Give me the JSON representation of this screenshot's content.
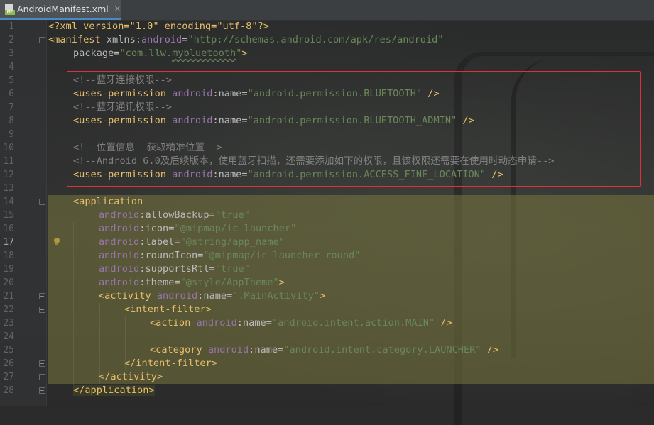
{
  "tab": {
    "title": "AndroidManifest.xml",
    "icon_badge": "MF"
  },
  "line_numbers": [
    "1",
    "2",
    "3",
    "4",
    "5",
    "6",
    "7",
    "8",
    "9",
    "10",
    "11",
    "12",
    "13",
    "14",
    "15",
    "16",
    "17",
    "18",
    "19",
    "20",
    "21",
    "22",
    "23",
    "24",
    "25",
    "26",
    "27",
    "28"
  ],
  "code": {
    "l1": {
      "decl": "<?xml version=\"1.0\" encoding=\"utf-8\"?>"
    },
    "l2": {
      "open": "<manifest ",
      "a1": "xmlns:",
      "a1ns": "android",
      "eq": "=",
      "v1": "\"http://schemas.android.com/apk/res/android\""
    },
    "l3": {
      "a": "package",
      "eq": "=",
      "v": "\"com.llw.",
      "v_squig": "mybluetooth",
      "v_end": "\"",
      "close": ">"
    },
    "l5": {
      "comment": "<!--蓝牙连接权限-->"
    },
    "l6": {
      "tag": "<uses-permission ",
      "ns": "android",
      "colon": ":",
      "attr": "name",
      "eq": "=",
      "val": "\"android.permission.BLUETOOTH\"",
      "end": " />"
    },
    "l7": {
      "comment": "<!--蓝牙通讯权限-->"
    },
    "l8": {
      "tag": "<uses-permission ",
      "ns": "android",
      "colon": ":",
      "attr": "name",
      "eq": "=",
      "val": "\"android.permission.BLUETOOTH_ADMIN\"",
      "end": " />"
    },
    "l10": {
      "comment": "<!--位置信息  获取精准位置-->"
    },
    "l11": {
      "comment": "<!--Android 6.0及后续版本，使用蓝牙扫描，还需要添加如下的权限，且该权限还需要在使用时动态申请-->"
    },
    "l12": {
      "tag": "<uses-permission ",
      "ns": "android",
      "colon": ":",
      "attr": "name",
      "eq": "=",
      "val": "\"android.permission.ACCESS_FINE_LOCATION\"",
      "end": " />"
    },
    "l14": {
      "tag": "<application"
    },
    "l15": {
      "ns": "android",
      "colon": ":",
      "attr": "allowBackup",
      "eq": "=",
      "val": "\"true\""
    },
    "l16": {
      "ns": "android",
      "colon": ":",
      "attr": "icon",
      "eq": "=",
      "val": "\"@mipmap/ic_launcher\""
    },
    "l17": {
      "ns": "android",
      "colon": ":",
      "attr": "label",
      "eq": "=",
      "val": "\"@string/app_name\""
    },
    "l18": {
      "ns": "android",
      "colon": ":",
      "attr": "roundIcon",
      "eq": "=",
      "val": "\"@mipmap/ic_launcher_round\""
    },
    "l19": {
      "ns": "android",
      "colon": ":",
      "attr": "supportsRtl",
      "eq": "=",
      "val": "\"true\""
    },
    "l20": {
      "ns": "android",
      "colon": ":",
      "attr": "theme",
      "eq": "=",
      "val": "\"@style/AppTheme\"",
      "close": ">"
    },
    "l21": {
      "tag": "<activity ",
      "ns": "android",
      "colon": ":",
      "attr": "name",
      "eq": "=",
      "val": "\".MainActivity\"",
      "close": ">"
    },
    "l22": {
      "tag": "<intent-filter>"
    },
    "l23": {
      "tag": "<action ",
      "ns": "android",
      "colon": ":",
      "attr": "name",
      "eq": "=",
      "val": "\"android.intent.action.MAIN\"",
      "end": " />"
    },
    "l25": {
      "tag": "<category ",
      "ns": "android",
      "colon": ":",
      "attr": "name",
      "eq": "=",
      "val": "\"android.intent.category.LAUNCHER\"",
      "end": " />"
    },
    "l26": {
      "tag": "</intent-filter>"
    },
    "l27": {
      "tag": "</activity>"
    },
    "l28": {
      "tag": "</application>"
    }
  },
  "colors": {
    "tag": "#e8bf6a",
    "namespace": "#9876aa",
    "value": "#6a8759",
    "comment": "#808080",
    "highlight_box": "#e0303a",
    "tab_underline": "#4a88c7"
  }
}
